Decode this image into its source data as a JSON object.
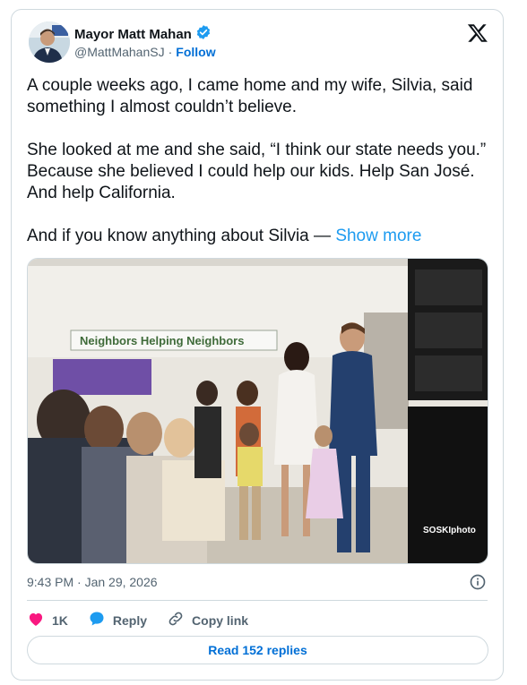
{
  "author": {
    "name": "Mayor Matt Mahan",
    "handle": "@MattMahanSJ",
    "separator": "·",
    "follow_label": "Follow"
  },
  "tweet": {
    "paragraphs": [
      "A couple weeks ago, I came home and my wife, Silvia, said something I almost couldn’t believe.",
      "She looked at me and she said, “I think our state needs you.” Because she believed I could help our kids. Help San José. And help California.",
      "And if you know anything about Silvia —"
    ],
    "show_more": "Show more"
  },
  "media": {
    "banner_text": "Neighbors Helping Neighbors",
    "watermark": "SOSKIphoto"
  },
  "meta": {
    "timestamp": "9:43 PM · Jan 29, 2026"
  },
  "actions": {
    "like_count": "1K",
    "reply_label": "Reply",
    "copy_link_label": "Copy link"
  },
  "replies_button": "Read 152 replies",
  "colors": {
    "accent": "#1d9bf0",
    "link": "#006fd6",
    "like": "#f91880",
    "muted": "#536471",
    "border": "#cfd9de"
  }
}
